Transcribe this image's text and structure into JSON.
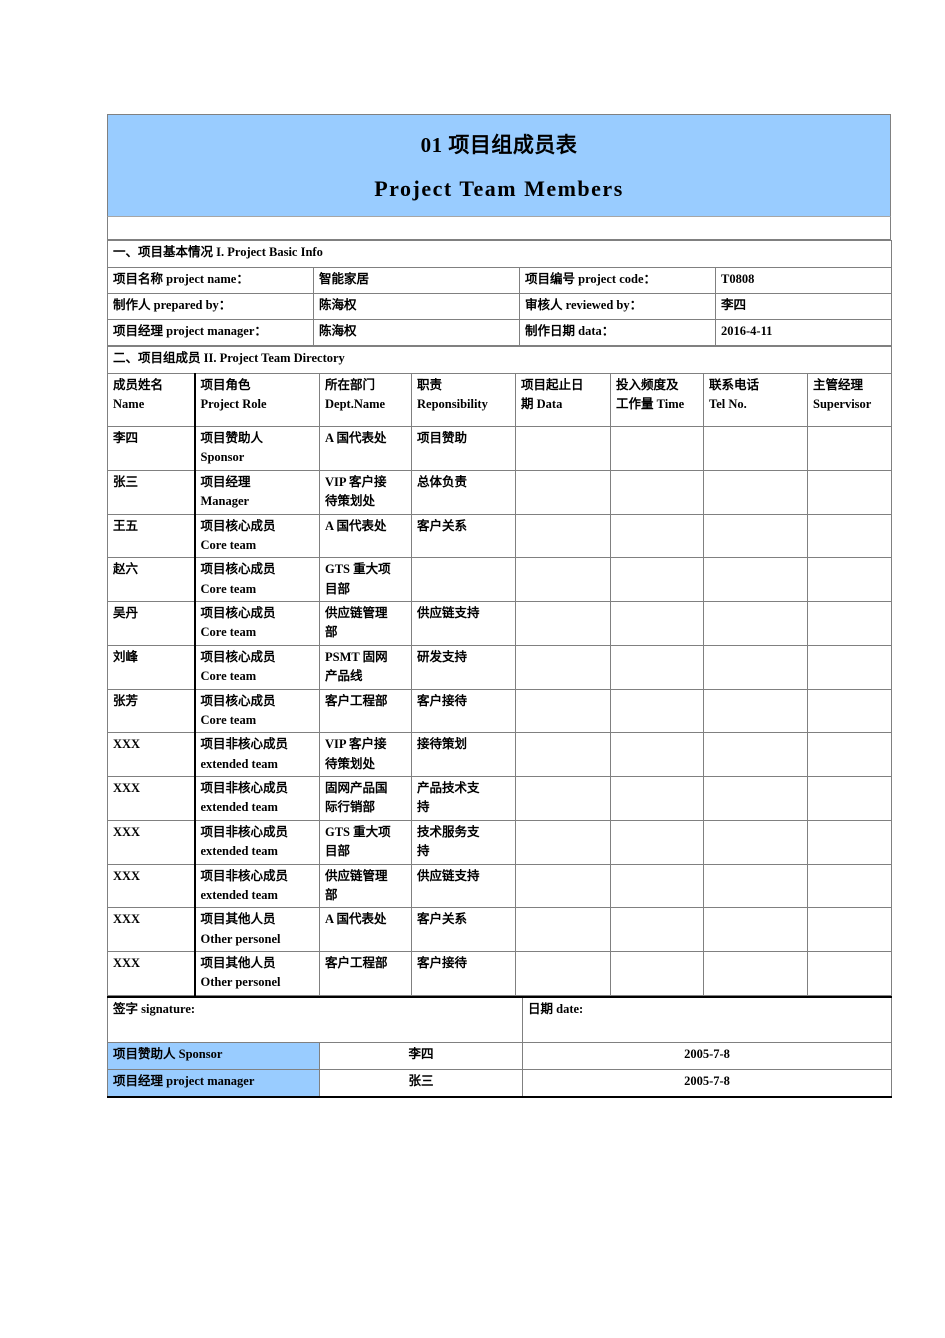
{
  "document": {
    "title_cn_number": "01",
    "title_cn": "项目组成员表",
    "title_en": "Project  Team  Members"
  },
  "section1": {
    "heading": "一、项目基本情况 I. Project Basic Info",
    "rows": [
      {
        "label_left": "项目名称 project name：",
        "value_left": "智能家居",
        "label_right": "项目编号 project code：",
        "value_right": "T0808"
      },
      {
        "label_left": "制作人 prepared by：",
        "value_left": "陈海权",
        "label_right": "审核人 reviewed by：",
        "value_right": "李四"
      },
      {
        "label_left": "项目经理 project manager：",
        "value_left": "陈海权",
        "label_right": "制作日期 data：",
        "value_right": "2016-4-11"
      }
    ]
  },
  "section2": {
    "heading": "二、项目组成员 II. Project Team Directory",
    "columns": [
      {
        "cn": "成员姓名",
        "en": "Name"
      },
      {
        "cn": "项目角色",
        "en": "Project  Role"
      },
      {
        "cn": "所在部门",
        "en": "Dept.Name"
      },
      {
        "cn": "职责",
        "en": "Reponsibility"
      },
      {
        "cn": "项目起止日",
        "en": "期  Data"
      },
      {
        "cn": "投入频度及",
        "en": "工作量  Time"
      },
      {
        "cn": "联系电话",
        "en": "Tel    No."
      },
      {
        "cn": "主管经理",
        "en": "Supervisor"
      }
    ],
    "members": [
      {
        "name": "李四",
        "role_cn": "项目赞助人",
        "role_en": "Sponsor",
        "dept_l1": "A 国代表处",
        "dept_l2": "",
        "resp_l1": "项目赞助",
        "resp_l2": "",
        "date": "",
        "time": "",
        "tel": "",
        "supervisor": ""
      },
      {
        "name": "张三",
        "role_cn": "项目经理",
        "role_en": "Manager",
        "dept_l1": "VIP 客户接",
        "dept_l2": "待策划处",
        "resp_l1": "总体负责",
        "resp_l2": "",
        "date": "",
        "time": "",
        "tel": "",
        "supervisor": ""
      },
      {
        "name": "王五",
        "role_cn": "项目核心成员",
        "role_en": "Core  team",
        "dept_l1": "A 国代表处",
        "dept_l2": "",
        "resp_l1": "客户关系",
        "resp_l2": "",
        "date": "",
        "time": "",
        "tel": "",
        "supervisor": ""
      },
      {
        "name": "赵六",
        "role_cn": "项目核心成员",
        "role_en": "Core  team",
        "dept_l1": "GTS 重大项",
        "dept_l2": "目部",
        "resp_l1": "",
        "resp_l2": "",
        "date": "",
        "time": "",
        "tel": "",
        "supervisor": ""
      },
      {
        "name": "吴丹",
        "role_cn": "项目核心成员",
        "role_en": "Core  team",
        "dept_l1": "供应链管理",
        "dept_l2": "部",
        "resp_l1": "供应链支持",
        "resp_l2": "",
        "date": "",
        "time": "",
        "tel": "",
        "supervisor": ""
      },
      {
        "name": "刘峰",
        "role_cn": "项目核心成员",
        "role_en": "Core  team",
        "dept_l1": "PSMT 固网",
        "dept_l2": "产品线",
        "resp_l1": "研发支持",
        "resp_l2": "",
        "date": "",
        "time": "",
        "tel": "",
        "supervisor": ""
      },
      {
        "name": "张芳",
        "role_cn": "项目核心成员",
        "role_en": "Core  team",
        "dept_l1": "客户工程部",
        "dept_l2": "",
        "resp_l1": "客户接待",
        "resp_l2": "",
        "date": "",
        "time": "",
        "tel": "",
        "supervisor": ""
      },
      {
        "name": "XXX",
        "role_cn": "项目非核心成员",
        "role_en": "extended  team",
        "dept_l1": "VIP 客户接",
        "dept_l2": "待策划处",
        "resp_l1": "接待策划",
        "resp_l2": "",
        "date": "",
        "time": "",
        "tel": "",
        "supervisor": ""
      },
      {
        "name": "XXX",
        "role_cn": "项目非核心成员",
        "role_en": "extended  team",
        "dept_l1": "固网产品国",
        "dept_l2": "际行销部",
        "resp_l1": "产品技术支",
        "resp_l2": "持",
        "date": "",
        "time": "",
        "tel": "",
        "supervisor": ""
      },
      {
        "name": "XXX",
        "role_cn": "项目非核心成员",
        "role_en": "extended  team",
        "dept_l1": "GTS 重大项",
        "dept_l2": "目部",
        "resp_l1": "技术服务支",
        "resp_l2": "持",
        "date": "",
        "time": "",
        "tel": "",
        "supervisor": ""
      },
      {
        "name": "XXX",
        "role_cn": "项目非核心成员",
        "role_en": "extended  team",
        "dept_l1": "供应链管理",
        "dept_l2": "部",
        "resp_l1": "供应链支持",
        "resp_l2": "",
        "date": "",
        "time": "",
        "tel": "",
        "supervisor": ""
      },
      {
        "name": "XXX",
        "role_cn": "项目其他人员",
        "role_en": "Other  personel",
        "dept_l1": "A 国代表处",
        "dept_l2": "",
        "resp_l1": "客户关系",
        "resp_l2": "",
        "date": "",
        "time": "",
        "tel": "",
        "supervisor": ""
      },
      {
        "name": "XXX",
        "role_cn": "项目其他人员",
        "role_en": "Other  personel",
        "dept_l1": "客户工程部",
        "dept_l2": "",
        "resp_l1": "客户接待",
        "resp_l2": "",
        "date": "",
        "time": "",
        "tel": "",
        "supervisor": ""
      }
    ]
  },
  "signature": {
    "signature_label": "签字 signature:",
    "date_label": "日期 date:",
    "rows": [
      {
        "role": "项目赞助人 Sponsor",
        "name": "李四",
        "date": "2005-7-8"
      },
      {
        "role": "项目经理 project manager",
        "name": "张三",
        "date": "2005-7-8"
      }
    ]
  },
  "colors": {
    "header_blue": "#99ccff",
    "border_gray": "#808080",
    "border_black": "#000000"
  }
}
